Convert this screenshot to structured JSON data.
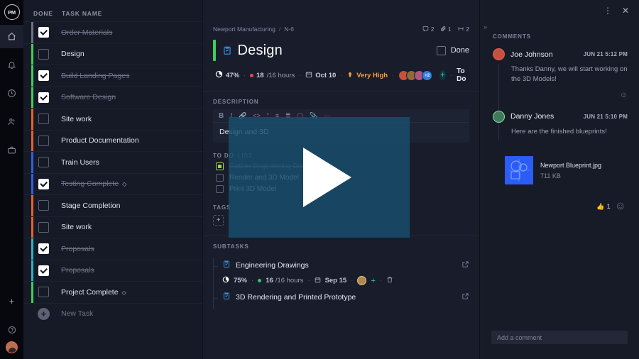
{
  "app": {
    "logo_text": "PM"
  },
  "window": {
    "menu_icon": "kebab-menu-icon",
    "close_icon": "close-icon"
  },
  "rail": {
    "items": [
      {
        "name": "home-icon",
        "label": "Home"
      },
      {
        "name": "bell-icon",
        "label": "Notifications"
      },
      {
        "name": "clock-icon",
        "label": "Time"
      },
      {
        "name": "people-icon",
        "label": "Team"
      },
      {
        "name": "briefcase-icon",
        "label": "Portfolio"
      }
    ],
    "add_label": "+",
    "help_label": "?"
  },
  "tasklist": {
    "col_done": "DONE",
    "col_name": "TASK NAME",
    "new_task_label": "New Task",
    "rows": [
      {
        "name": "Order Materials",
        "done": true,
        "milestone": false,
        "stripe": "#6b7280"
      },
      {
        "name": "Design",
        "done": false,
        "milestone": false,
        "stripe": "#3ecf5a"
      },
      {
        "name": "Build Landing Pages",
        "done": true,
        "milestone": false,
        "stripe": "#3ecf5a"
      },
      {
        "name": "Software Design",
        "done": true,
        "milestone": false,
        "stripe": "#3ecf5a"
      },
      {
        "name": "Site work",
        "done": false,
        "milestone": false,
        "stripe": "#e8622a"
      },
      {
        "name": "Product Documentation",
        "done": false,
        "milestone": false,
        "stripe": "#e8622a"
      },
      {
        "name": "Train Users",
        "done": false,
        "milestone": false,
        "stripe": "#2f5fe0"
      },
      {
        "name": "Testing Complete",
        "done": true,
        "milestone": true,
        "stripe": "#2f5fe0"
      },
      {
        "name": "Stage Completion",
        "done": false,
        "milestone": false,
        "stripe": "#e8622a"
      },
      {
        "name": "Site work",
        "done": false,
        "milestone": false,
        "stripe": "#e8622a"
      },
      {
        "name": "Proposals",
        "done": true,
        "milestone": false,
        "stripe": "#27b5c9"
      },
      {
        "name": "Proposals",
        "done": true,
        "milestone": false,
        "stripe": "#27b5c9"
      },
      {
        "name": "Project Complete",
        "done": false,
        "milestone": true,
        "stripe": "#3ecf5a"
      }
    ]
  },
  "detail": {
    "breadcrumb": {
      "project": "Newport Manufacturing",
      "separator": "/",
      "code": "N-6"
    },
    "counters": {
      "comments": "2",
      "attachments": "1",
      "subtasks": "2"
    },
    "title": "Design",
    "done_label": "Done",
    "meta": {
      "progress": "47%",
      "hours_logged": "18",
      "hours_total": "/16 hours",
      "date": "Oct 10",
      "priority": "Very High",
      "avatar_more": "+2",
      "status": "To Do"
    },
    "description_label": "DESCRIPTION",
    "description_text": "Design and 3D",
    "toolbar": {
      "bold": "B",
      "italic": "I"
    },
    "todo": {
      "label": "TO DO",
      "label2": "LIST",
      "items": [
        {
          "text": "Gather Engineering Dra",
          "done": true
        },
        {
          "text": "Render and 3D Model",
          "done": false
        },
        {
          "text": "Print 3D Model",
          "done": false
        }
      ]
    },
    "tags_label": "TAGS",
    "tag_add": "+",
    "subtasks_label": "SUBTASKS",
    "subtasks": [
      {
        "title": "Engineering Drawings",
        "progress": "75%",
        "hours_logged": "16",
        "hours_total": "/16 hours",
        "date": "Sep 15"
      },
      {
        "title": "3D Rendering and Printed Prototype",
        "progress": "",
        "hours_logged": "",
        "hours_total": "",
        "date": ""
      }
    ]
  },
  "comments_panel": {
    "collapse_icon": "chevron-right-icon",
    "header": "COMMENTS",
    "comments": [
      {
        "author": "Joe Johnson",
        "time": "JUN 21 5:12 PM",
        "body": "Thanks Danny, we will start working on the 3D Models!"
      },
      {
        "author": "Danny Jones",
        "time": "JUN 21 5:10 PM",
        "body": "Here are the finished blueprints!"
      }
    ],
    "attachment": {
      "name": "Newport Blueprint.jpg",
      "size": "711 KB"
    },
    "reaction": {
      "emoji": "👍",
      "count": "1",
      "add": "☺"
    },
    "input_placeholder": "Add a comment"
  },
  "colors": {
    "accent_green": "#3ecf5a",
    "priority_orange": "#f0a13c",
    "hours_red": "#e5484d",
    "hours_green": "#35c46a",
    "teal": "#2fd4b4",
    "blue": "#2f7fe0"
  }
}
